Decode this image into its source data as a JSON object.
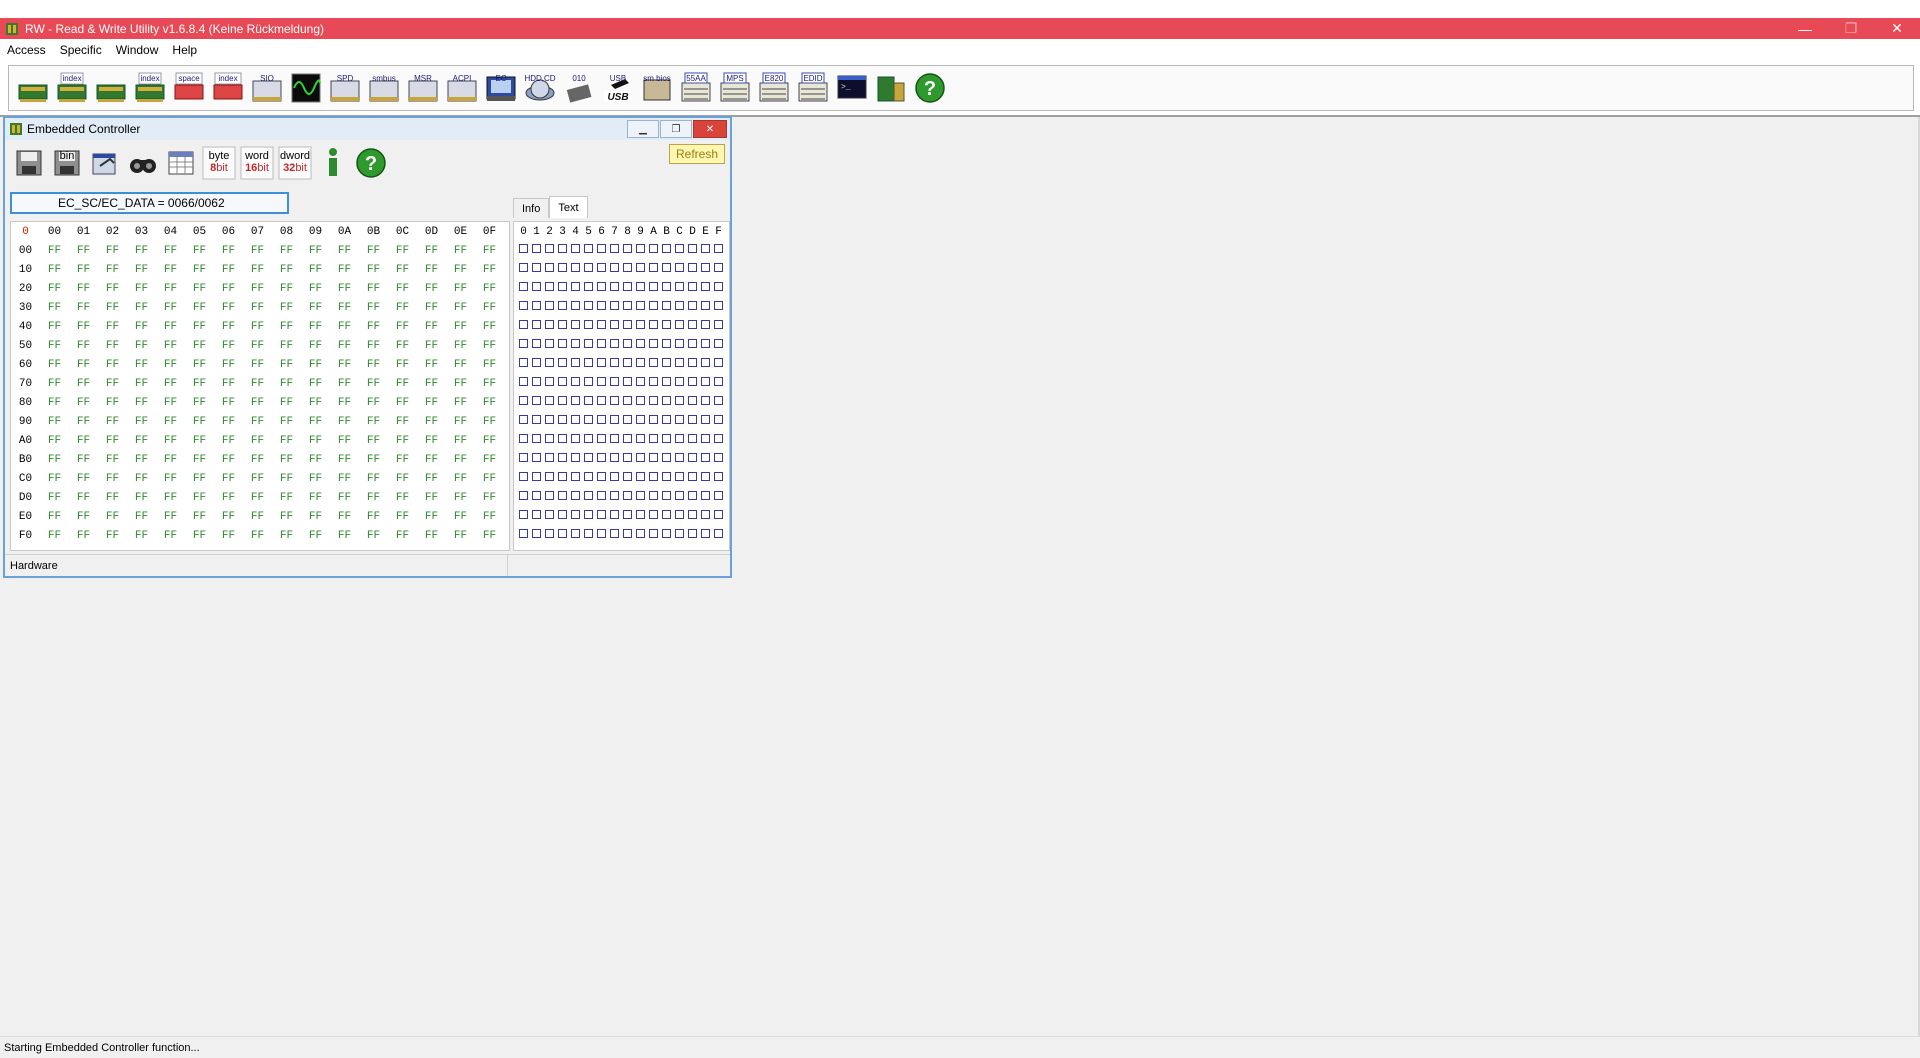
{
  "window": {
    "title": "RW - Read & Write Utility v1.6.8.4 (Keine Rückmeldung)",
    "minimize": "—",
    "restore": "❐",
    "close": "✕"
  },
  "menu": [
    "Access",
    "Specific",
    "Window",
    "Help"
  ],
  "toolbar": {
    "buttons": [
      {
        "icon": "pci-icon",
        "label": ""
      },
      {
        "icon": "index-pci-icon",
        "label": "index"
      },
      {
        "icon": "memory-icon",
        "label": ""
      },
      {
        "icon": "index-memory-icon",
        "label": "index"
      },
      {
        "icon": "io-space-icon",
        "label": "space"
      },
      {
        "icon": "io-index-icon",
        "label": "index"
      },
      {
        "icon": "sio-icon",
        "label": "SIO"
      },
      {
        "icon": "clock-gen-icon",
        "label": ""
      },
      {
        "icon": "spd-icon",
        "label": "SPD"
      },
      {
        "icon": "smbus-icon",
        "label": "smbus"
      },
      {
        "icon": "msr-icon",
        "label": "MSR"
      },
      {
        "icon": "acpi-icon",
        "label": "ACPI"
      },
      {
        "icon": "ec-icon",
        "label": "EC"
      },
      {
        "icon": "hdd-cd-icon",
        "label": "HDD,CD"
      },
      {
        "icon": "flash-icon",
        "label": "010"
      },
      {
        "icon": "usb-icon",
        "label": "USB"
      },
      {
        "icon": "smbios-icon",
        "label": "sm bios"
      },
      {
        "icon": "55aa-icon",
        "label": "55AA"
      },
      {
        "icon": "mps-icon",
        "label": "MPS"
      },
      {
        "icon": "e820-icon",
        "label": "E820"
      },
      {
        "icon": "edid-icon",
        "label": "EDID"
      },
      {
        "icon": "command-icon",
        "label": ""
      },
      {
        "icon": "device-icon",
        "label": ""
      },
      {
        "icon": "help-icon",
        "label": ""
      }
    ]
  },
  "ec_window": {
    "title": "Embedded Controller",
    "toolbar": [
      {
        "icon": "save-icon",
        "t1": "",
        "t2": ""
      },
      {
        "icon": "save-bin-icon",
        "t1": "bin",
        "t2": ""
      },
      {
        "icon": "load-icon",
        "t1": "",
        "t2": ""
      },
      {
        "icon": "find-icon",
        "t1": "",
        "t2": ""
      },
      {
        "icon": "table-icon",
        "t1": "",
        "t2": ""
      },
      {
        "icon": "byte-icon",
        "t1": "byte",
        "t2": "8",
        "t2b": "bit"
      },
      {
        "icon": "word-icon",
        "t1": "word",
        "t2": "16",
        "t2b": "bit"
      },
      {
        "icon": "dword-icon",
        "t1": "dword",
        "t2": "32",
        "t2b": "bit"
      },
      {
        "icon": "info-icon",
        "t1": "",
        "t2": ""
      },
      {
        "icon": "help-icon",
        "t1": "",
        "t2": ""
      }
    ],
    "refresh_label": "Refresh",
    "address": "EC_SC/EC_DATA = 0066/0062",
    "tabs": [
      "Info",
      "Text"
    ],
    "active_tab": "Text",
    "grid_corner": "0",
    "col_headers": [
      "00",
      "01",
      "02",
      "03",
      "04",
      "05",
      "06",
      "07",
      "08",
      "09",
      "0A",
      "0B",
      "0C",
      "0D",
      "0E",
      "0F"
    ],
    "row_headers": [
      "00",
      "10",
      "20",
      "30",
      "40",
      "50",
      "60",
      "70",
      "80",
      "90",
      "A0",
      "B0",
      "C0",
      "D0",
      "E0",
      "F0"
    ],
    "cell_value": "FF",
    "text_headers": [
      "0",
      "1",
      "2",
      "3",
      "4",
      "5",
      "6",
      "7",
      "8",
      "9",
      "A",
      "B",
      "C",
      "D",
      "E",
      "F"
    ],
    "status_left": "Hardware",
    "status_right": ""
  },
  "statusbar": {
    "text": "Starting Embedded Controller function..."
  },
  "colors": {
    "titlebar": "#e74a56",
    "hex_values": "#2f8a2f",
    "corner": "#d02000",
    "active_child_border": "#6aa1d8"
  }
}
